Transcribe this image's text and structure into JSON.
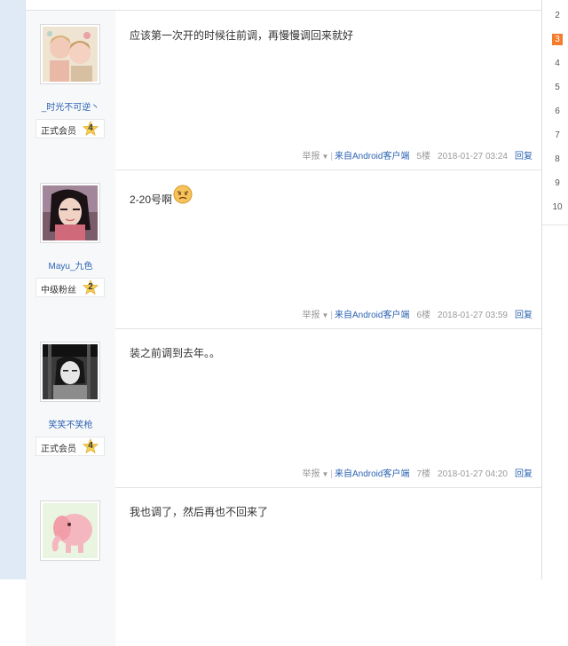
{
  "posts": [
    {
      "author": "_时光不可逆丶",
      "badge": {
        "title": "正式会员",
        "level": "4"
      },
      "content": "应该第一次开的时候往前调，再慢慢调回来就好",
      "avatar_icon": "anime-girl-avatar",
      "meta": {
        "report": "举报",
        "client": "来自Android客户端",
        "floor": "5楼",
        "time": "2018-01-27 03:24",
        "reply": "回复"
      }
    },
    {
      "author": "Mayu_九色",
      "badge": {
        "title": "中级粉丝",
        "level": "2"
      },
      "content": "2-20号啊",
      "emoji": "pouting-face-icon",
      "avatar_icon": "girl-photo-avatar",
      "meta": {
        "report": "举报",
        "client": "来自Android客户端",
        "floor": "6楼",
        "time": "2018-01-27 03:59",
        "reply": "回复"
      }
    },
    {
      "author": "笑笑不笑枪",
      "badge": {
        "title": "正式会员",
        "level": "4"
      },
      "content": "装之前调到去年。。",
      "avatar_icon": "bw-photo-avatar",
      "meta": {
        "report": "举报",
        "client": "来自Android客户端",
        "floor": "7楼",
        "time": "2018-01-27 04:20",
        "reply": "回复"
      }
    },
    {
      "author": "",
      "content": "我也调了，然后再也不回来了",
      "avatar_icon": "pink-elephant-avatar"
    }
  ],
  "pager": [
    "2",
    "3",
    "4",
    "5",
    "6",
    "7",
    "8",
    "9",
    "10"
  ],
  "pager_active": "3",
  "colors": {
    "link": "#2d64b3",
    "active_page": "#f47c2c",
    "author_bg": "#f7f8fa",
    "left_strip": "#dfeaf6"
  }
}
